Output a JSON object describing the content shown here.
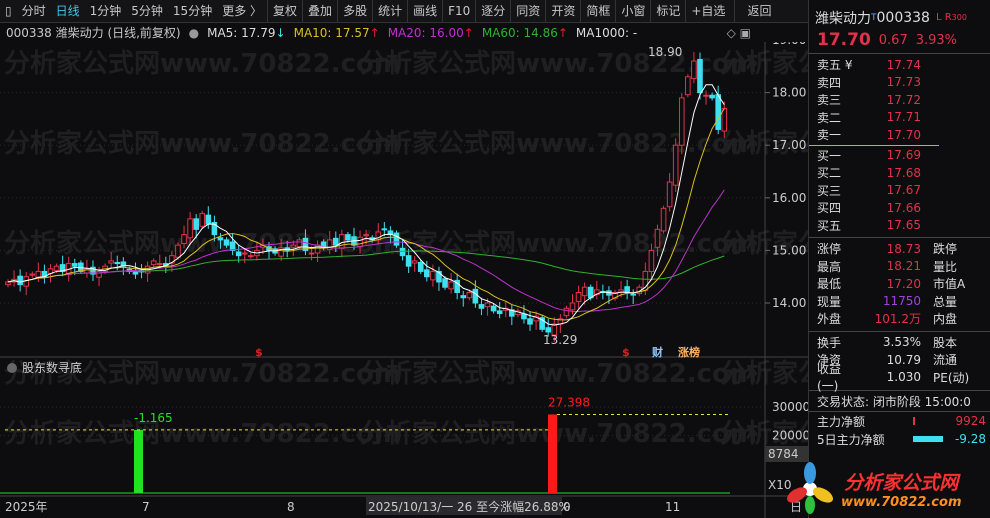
{
  "toolbar": {
    "items": [
      "分时",
      "日线",
      "1分钟",
      "5分钟",
      "15分钟",
      "更多 〉",
      "复权",
      "叠加",
      "多股",
      "统计",
      "画线",
      "F10",
      "逐分",
      "同资",
      "开资",
      "简框",
      "小窗",
      "标记",
      "+自选",
      "返回"
    ],
    "active": "日线"
  },
  "info": {
    "code_title": "000338 潍柴动力 (日线,前复权)",
    "ma5": "MA5: 17.79",
    "ma10": "MA10: 17.57",
    "ma20": "MA20: 16.00",
    "ma60": "MA60: 14.86",
    "ma1000": "MA1000: -",
    "ma5_arrow": "↓",
    "up_arrow": "↑"
  },
  "watermark": "分析家公式网www.70822.com",
  "chart_data": {
    "type": "candlestick",
    "y_ticks": [
      "19.00",
      "18.00",
      "17.00",
      "16.00",
      "15.00",
      "14.00"
    ],
    "ylim": [
      13.0,
      19.0
    ],
    "closes": [
      14.4,
      14.45,
      14.35,
      14.5,
      14.55,
      14.6,
      14.5,
      14.65,
      14.7,
      14.6,
      14.75,
      14.7,
      14.6,
      14.65,
      14.55,
      14.6,
      14.7,
      14.8,
      14.75,
      14.7,
      14.6,
      14.55,
      14.6,
      14.7,
      14.8,
      14.75,
      14.7,
      14.9,
      15.1,
      15.3,
      15.6,
      15.4,
      15.7,
      15.5,
      15.3,
      15.2,
      15.1,
      15.0,
      14.9,
      14.95,
      14.9,
      15.0,
      15.1,
      15.0,
      14.95,
      15.05,
      15.0,
      15.1,
      15.2,
      15.0,
      14.95,
      15.1,
      15.05,
      15.2,
      15.1,
      15.3,
      15.2,
      15.1,
      15.25,
      15.3,
      15.2,
      15.35,
      15.4,
      15.3,
      15.1,
      14.9,
      14.7,
      14.8,
      14.6,
      14.5,
      14.6,
      14.4,
      14.3,
      14.4,
      14.2,
      14.1,
      14.2,
      14.0,
      13.9,
      14.0,
      13.85,
      13.8,
      13.9,
      13.75,
      13.85,
      13.7,
      13.6,
      13.75,
      13.5,
      13.45,
      13.6,
      13.7,
      13.9,
      14.0,
      14.2,
      14.3,
      14.1,
      14.25,
      14.2,
      14.15,
      14.2,
      14.25,
      14.2,
      14.15,
      14.3,
      14.6,
      15.0,
      15.4,
      15.8,
      16.3,
      17.0,
      17.9,
      18.3,
      18.6,
      18.0,
      17.95,
      17.9,
      17.3,
      17.7
    ],
    "high_label": "18.90",
    "low_label": "13.29",
    "markers": [
      {
        "text": "$",
        "color": "#e02020"
      },
      {
        "text": "$",
        "color": "#e02020"
      },
      {
        "text": "财",
        "color": "#8ec8ff"
      },
      {
        "text": "涨榜",
        "color": "#ffb060"
      }
    ],
    "x_labels": [
      "2025年",
      "7",
      "8",
      "2025/10/13/一 26 至今涨幅26.88%",
      "0",
      "11"
    ]
  },
  "indicator": {
    "title": "股东数寻底",
    "y_ticks": [
      "30000",
      "20000"
    ],
    "cursor_value": "8784",
    "scale": "X10",
    "bars": [
      {
        "label": "-1.165",
        "value": 22000,
        "color": "#22e022"
      },
      {
        "label": "27.398",
        "value": 27398,
        "color": "#ff1a1a"
      }
    ]
  },
  "panel": {
    "name": "潍柴动力",
    "code": "000338",
    "tag_t": "T",
    "tag_lr": "L R",
    "tag_300": "300",
    "price": "17.70",
    "change": "0.67",
    "pct": "3.93%",
    "asks": [
      {
        "l": "卖五",
        "v": "17.74"
      },
      {
        "l": "卖四",
        "v": "17.73"
      },
      {
        "l": "卖三",
        "v": "17.72"
      },
      {
        "l": "卖二",
        "v": "17.71"
      },
      {
        "l": "卖一",
        "v": "17.70"
      }
    ],
    "yen": "¥",
    "bids": [
      {
        "l": "买一",
        "v": "17.69"
      },
      {
        "l": "买二",
        "v": "17.68"
      },
      {
        "l": "买三",
        "v": "17.67"
      },
      {
        "l": "买四",
        "v": "17.66"
      },
      {
        "l": "买五",
        "v": "17.65"
      }
    ],
    "stats1": [
      {
        "l": "涨停",
        "v": "18.73",
        "l2": "跌停"
      },
      {
        "l": "最高",
        "v": "18.21",
        "l2": "量比"
      },
      {
        "l": "最低",
        "v": "17.20",
        "l2": "市值A"
      },
      {
        "l": "现量",
        "v": "11750",
        "l2": "总量"
      },
      {
        "l": "外盘",
        "v": "101.2万",
        "l2": "内盘"
      }
    ],
    "stats2": [
      {
        "l": "换手",
        "v": "3.53%",
        "l2": "股本"
      },
      {
        "l": "净资",
        "v": "10.79",
        "l2": "流通"
      },
      {
        "l": "收益(一)",
        "v": "1.030",
        "l2": "PE(动)"
      }
    ],
    "status": "交易状态: 闭市阶段 15:00:0",
    "flow": [
      {
        "l": "主力净额",
        "v": "9924"
      },
      {
        "l": "5日主力净额",
        "v": "-9.28"
      }
    ],
    "right_axis_label": "日"
  },
  "logo": {
    "text": "分析家公式网",
    "url": "www.70822.com"
  }
}
